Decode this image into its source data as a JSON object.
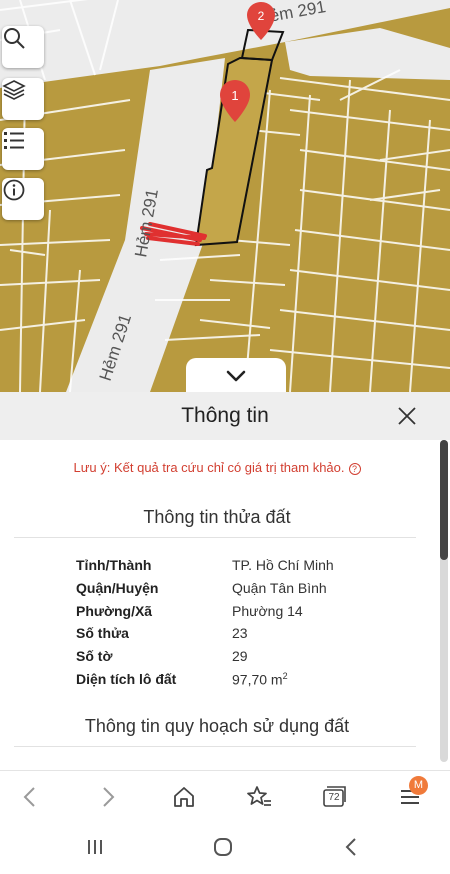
{
  "map": {
    "road_labels": [
      "Hẻm 291",
      "Hẻm 291",
      "Hẻm 291"
    ],
    "markers": [
      "1",
      "2"
    ],
    "controls": [
      {
        "icon": "search-icon"
      },
      {
        "icon": "layers-icon"
      },
      {
        "icon": "list-icon"
      },
      {
        "icon": "info-icon"
      }
    ],
    "colors": {
      "parcel": "#b89a3f",
      "road": "#ececec",
      "marker": "#e0443c",
      "selected_outline": "#111111"
    }
  },
  "panel": {
    "title": "Thông tin",
    "note": "Lưu ý: Kết quả tra cứu chỉ có giá trị tham khảo.",
    "note_icon": "?",
    "section1_title": "Thông tin thửa đất",
    "section2_title": "Thông tin quy hoạch sử dụng đất",
    "rows": [
      {
        "label": "Tỉnh/Thành",
        "value": "TP. Hồ Chí Minh"
      },
      {
        "label": "Quận/Huyện",
        "value": "Quận Tân Bình"
      },
      {
        "label": "Phường/Xã",
        "value": "Phường 14"
      },
      {
        "label": "Số thửa",
        "value": "23"
      },
      {
        "label": "Số tờ",
        "value": "29"
      },
      {
        "label": "Diện tích lô đất",
        "value": "97,70 m",
        "unit_sup": "2"
      }
    ]
  },
  "browser": {
    "tab_count": "72",
    "profile_initial": "M",
    "accent": "#f07a3a"
  }
}
